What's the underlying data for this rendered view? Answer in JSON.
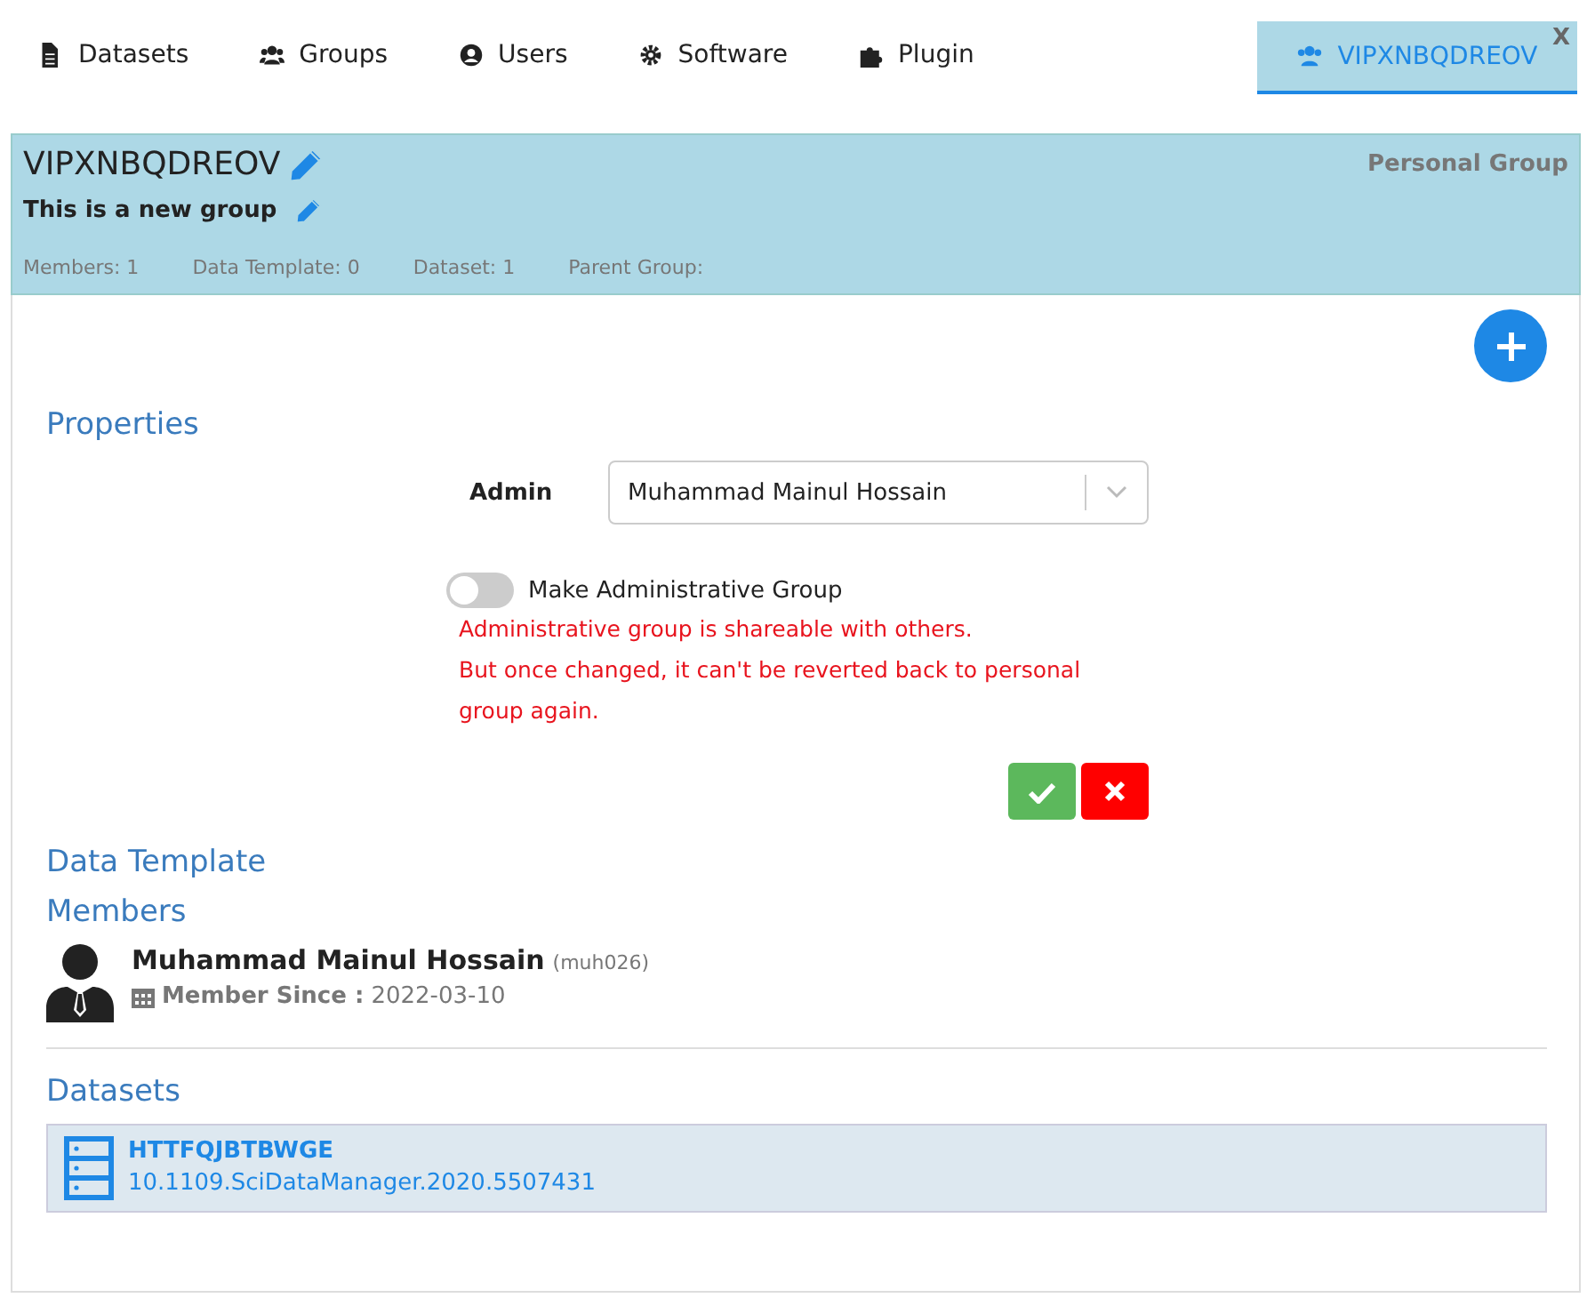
{
  "nav": [
    {
      "label": "Datasets",
      "selected": false
    },
    {
      "label": "Groups",
      "selected": false
    },
    {
      "label": "Users",
      "selected": false
    },
    {
      "label": "Software",
      "selected": false
    },
    {
      "label": "Plugin",
      "selected": false
    }
  ],
  "open_tab": {
    "label": "VIPXNBQDREOV",
    "close": "X",
    "selected": true
  },
  "header": {
    "title": "VIPXNBQDREOV",
    "description": "This is a new group",
    "type": "Personal Group",
    "stats": [
      "Members: 1",
      "Data Template: 0",
      "Dataset: 1",
      "Parent Group:"
    ]
  },
  "properties": {
    "heading": "Properties",
    "admin_label": "Admin",
    "admin_value": "Muhammad Mainul Hossain",
    "toggle": {
      "label": "Make Administrative Group",
      "on": false
    },
    "warnings": [
      "Administrative group is shareable with others.",
      "But once changed, it can't be reverted back to personal group again."
    ]
  },
  "data_template": {
    "heading": "Data Template"
  },
  "members": {
    "heading": "Members",
    "items": [
      {
        "name": "Muhammad Mainul Hossain",
        "username": "(muh026)",
        "since_label": "Member Since :",
        "since": "2022-03-10"
      }
    ]
  },
  "datasets": {
    "heading": "Datasets",
    "items": [
      {
        "name": "HTTFQJBTBWGE",
        "doi": "10.1109.SciDataManager.2020.5507431"
      }
    ]
  }
}
